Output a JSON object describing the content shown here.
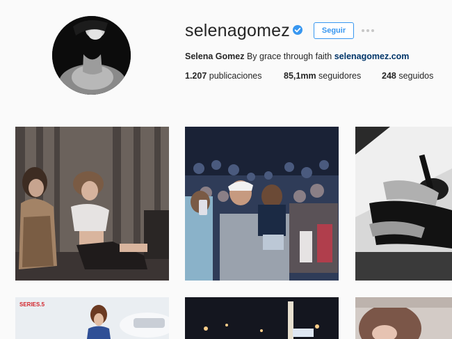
{
  "profile": {
    "username": "selenagomez",
    "verified": true,
    "follow_label": "Seguir",
    "full_name": "Selena Gomez",
    "bio": "By grace through faith",
    "website": "selenagomez.com",
    "stats": {
      "posts_count": "1.207",
      "posts_label": "publicaciones",
      "followers_count": "85,1mm",
      "followers_label": "seguidores",
      "following_count": "248",
      "following_label": "seguidos"
    }
  },
  "tiles": {
    "row2_tile1_caption": "SERIES.5"
  },
  "colors": {
    "accent": "#3897f0",
    "link": "#003569",
    "background": "#fafafa",
    "text": "#262626"
  },
  "icons": [
    "verified-badge-icon",
    "more-options-icon"
  ]
}
